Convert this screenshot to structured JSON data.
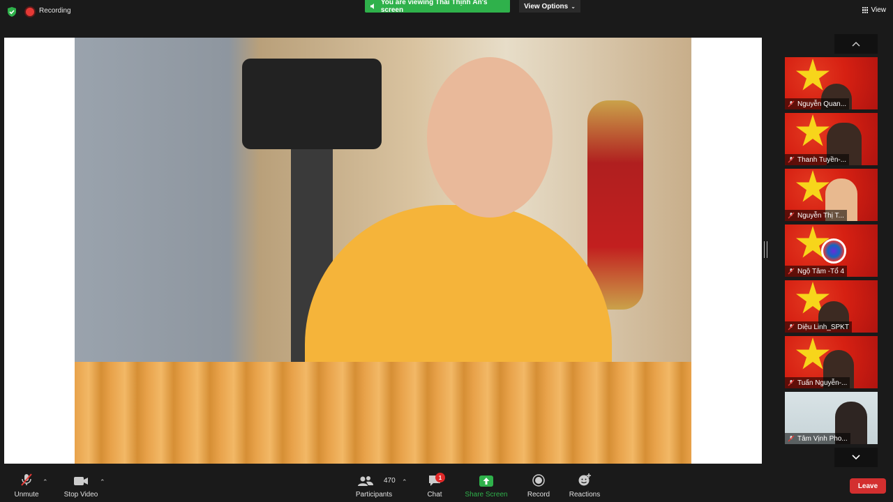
{
  "top_bar": {
    "recording_label": "Recording",
    "viewing_banner": "You are viewing Thái Thịnh Ân's screen",
    "view_options_label": "View Options",
    "view_label": "View"
  },
  "gallery": {
    "participants": [
      {
        "name": "Nguyễn Quan..."
      },
      {
        "name": "Thanh Tuyền-..."
      },
      {
        "name": "Nguyễn Thị T..."
      },
      {
        "name": "Ngộ Tâm -Tổ 4"
      },
      {
        "name": "Diệu Linh_SPKT"
      },
      {
        "name": "Tuấn Nguyễn-..."
      },
      {
        "name": "Tâm Vịnh Pho..."
      }
    ]
  },
  "toolbar": {
    "unmute_label": "Unmute",
    "stop_video_label": "Stop Video",
    "participants_label": "Participants",
    "participants_count": "470",
    "chat_label": "Chat",
    "chat_badge": "1",
    "share_screen_label": "Share Screen",
    "record_label": "Record",
    "reactions_label": "Reactions",
    "leave_label": "Leave"
  },
  "colors": {
    "share_green": "#2fb14b",
    "leave_red": "#d32f2f",
    "badge_red": "#e02828",
    "background": "#1a1a1a"
  }
}
